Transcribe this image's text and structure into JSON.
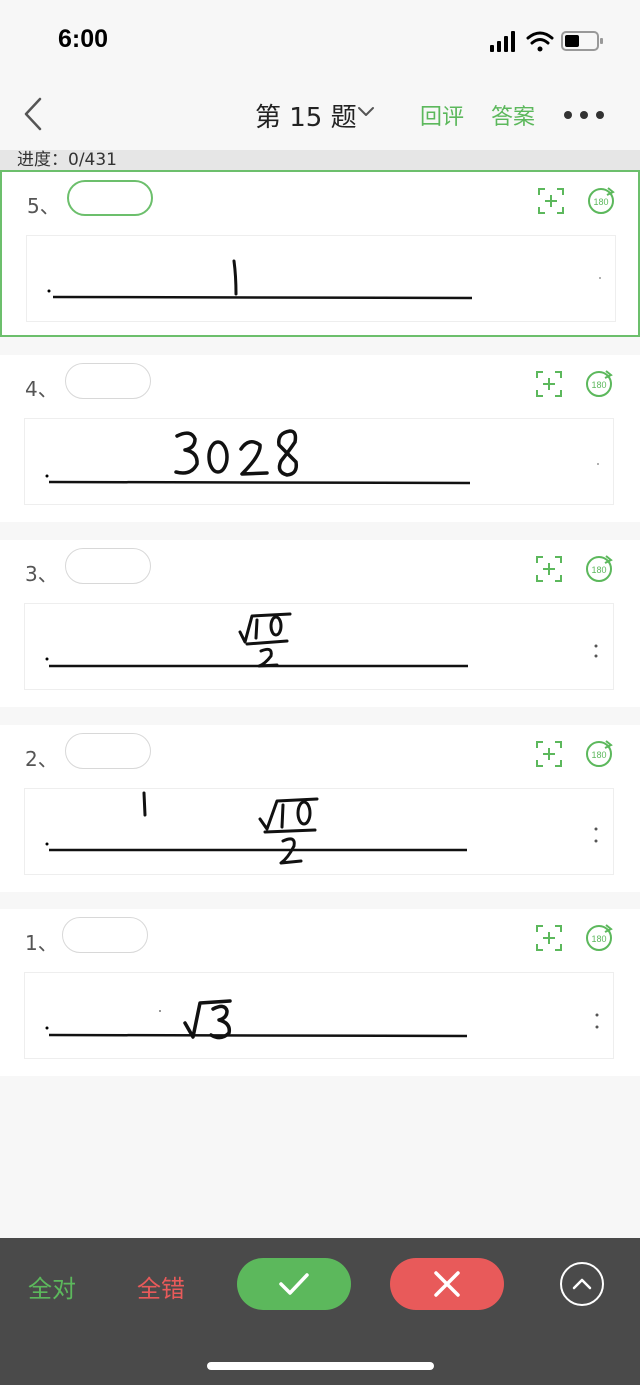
{
  "status": {
    "time": "6:00"
  },
  "nav": {
    "title": "第 15 题",
    "review": "回评",
    "answer": "答案"
  },
  "progress": {
    "label": "进度：0/431"
  },
  "cards": [
    {
      "number": "5、",
      "answer_text": "1"
    },
    {
      "number": "4、",
      "answer_text": "3028"
    },
    {
      "number": "3、",
      "answer_text": "√10/2"
    },
    {
      "number": "2、",
      "answer_text": "√10/2"
    },
    {
      "number": "1、",
      "answer_text": "√3"
    }
  ],
  "bottom": {
    "all_right": "全对",
    "all_wrong": "全错"
  },
  "colors": {
    "accent_green": "#5cb85c",
    "accent_red": "#e85a5a",
    "bottom_bar": "#4a4a4a"
  },
  "icons": {
    "back": "chevron-left-icon",
    "title_dropdown": "chevron-down-icon",
    "more": "more-dots-icon",
    "zoom": "zoom-plus-icon",
    "rotate": "rotate-180-icon",
    "check": "check-icon",
    "cross": "cross-icon",
    "collapse": "chevron-up-icon"
  }
}
